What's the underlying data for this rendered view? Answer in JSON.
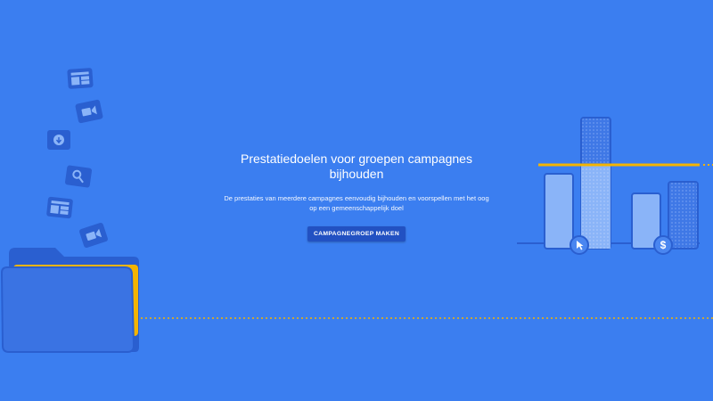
{
  "hero": {
    "title": "Prestatiedoelen voor groepen campagnes bijhouden",
    "description": "De prestaties van meerdere campagnes eenvoudig bijhouden en voorspellen met het oog op een gemeenschappelijk doel",
    "cta_label": "CAMPAGNEGROEP MAKEN"
  },
  "illustration": {
    "left_icons": [
      "layout-icon",
      "video-icon",
      "download-icon",
      "search-icon",
      "layout-icon",
      "video-icon"
    ],
    "folder": "folder-icon",
    "chart_icons": [
      "cursor-icon",
      "dollar-icon"
    ]
  },
  "colors": {
    "background": "#3b7ef0",
    "accent_yellow": "#f4b400",
    "dark_blue": "#2251c2",
    "light_blue": "#8ab4f8"
  }
}
